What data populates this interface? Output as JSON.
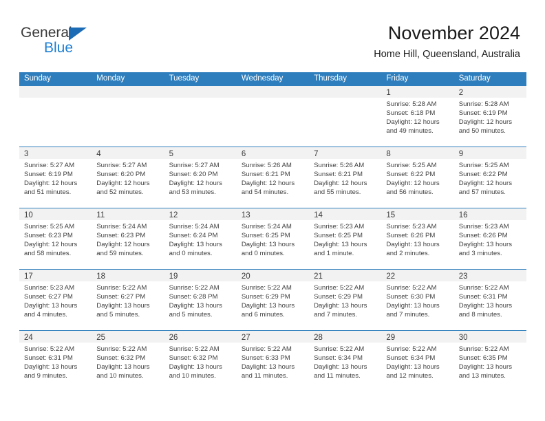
{
  "brand": {
    "name_part1": "General",
    "name_part2": "Blue",
    "accent_color": "#1c7fd4",
    "triangle_color": "#1c6bb5",
    "triangle_icon": "triangle-icon"
  },
  "header": {
    "title": "November 2024",
    "subtitle": "Home Hill, Queensland, Australia",
    "header_bg": "#2e7ebd",
    "datebar_bg": "#f2f2f2"
  },
  "calendar": {
    "weekday_headers": [
      "Sunday",
      "Monday",
      "Tuesday",
      "Wednesday",
      "Thursday",
      "Friday",
      "Saturday"
    ],
    "weeks": [
      [
        {
          "day": "",
          "sunrise": "",
          "sunset": "",
          "daylight1": "",
          "daylight2": ""
        },
        {
          "day": "",
          "sunrise": "",
          "sunset": "",
          "daylight1": "",
          "daylight2": ""
        },
        {
          "day": "",
          "sunrise": "",
          "sunset": "",
          "daylight1": "",
          "daylight2": ""
        },
        {
          "day": "",
          "sunrise": "",
          "sunset": "",
          "daylight1": "",
          "daylight2": ""
        },
        {
          "day": "",
          "sunrise": "",
          "sunset": "",
          "daylight1": "",
          "daylight2": ""
        },
        {
          "day": "1",
          "sunrise": "Sunrise: 5:28 AM",
          "sunset": "Sunset: 6:18 PM",
          "daylight1": "Daylight: 12 hours",
          "daylight2": "and 49 minutes."
        },
        {
          "day": "2",
          "sunrise": "Sunrise: 5:28 AM",
          "sunset": "Sunset: 6:19 PM",
          "daylight1": "Daylight: 12 hours",
          "daylight2": "and 50 minutes."
        }
      ],
      [
        {
          "day": "3",
          "sunrise": "Sunrise: 5:27 AM",
          "sunset": "Sunset: 6:19 PM",
          "daylight1": "Daylight: 12 hours",
          "daylight2": "and 51 minutes."
        },
        {
          "day": "4",
          "sunrise": "Sunrise: 5:27 AM",
          "sunset": "Sunset: 6:20 PM",
          "daylight1": "Daylight: 12 hours",
          "daylight2": "and 52 minutes."
        },
        {
          "day": "5",
          "sunrise": "Sunrise: 5:27 AM",
          "sunset": "Sunset: 6:20 PM",
          "daylight1": "Daylight: 12 hours",
          "daylight2": "and 53 minutes."
        },
        {
          "day": "6",
          "sunrise": "Sunrise: 5:26 AM",
          "sunset": "Sunset: 6:21 PM",
          "daylight1": "Daylight: 12 hours",
          "daylight2": "and 54 minutes."
        },
        {
          "day": "7",
          "sunrise": "Sunrise: 5:26 AM",
          "sunset": "Sunset: 6:21 PM",
          "daylight1": "Daylight: 12 hours",
          "daylight2": "and 55 minutes."
        },
        {
          "day": "8",
          "sunrise": "Sunrise: 5:25 AM",
          "sunset": "Sunset: 6:22 PM",
          "daylight1": "Daylight: 12 hours",
          "daylight2": "and 56 minutes."
        },
        {
          "day": "9",
          "sunrise": "Sunrise: 5:25 AM",
          "sunset": "Sunset: 6:22 PM",
          "daylight1": "Daylight: 12 hours",
          "daylight2": "and 57 minutes."
        }
      ],
      [
        {
          "day": "10",
          "sunrise": "Sunrise: 5:25 AM",
          "sunset": "Sunset: 6:23 PM",
          "daylight1": "Daylight: 12 hours",
          "daylight2": "and 58 minutes."
        },
        {
          "day": "11",
          "sunrise": "Sunrise: 5:24 AM",
          "sunset": "Sunset: 6:23 PM",
          "daylight1": "Daylight: 12 hours",
          "daylight2": "and 59 minutes."
        },
        {
          "day": "12",
          "sunrise": "Sunrise: 5:24 AM",
          "sunset": "Sunset: 6:24 PM",
          "daylight1": "Daylight: 13 hours",
          "daylight2": "and 0 minutes."
        },
        {
          "day": "13",
          "sunrise": "Sunrise: 5:24 AM",
          "sunset": "Sunset: 6:25 PM",
          "daylight1": "Daylight: 13 hours",
          "daylight2": "and 0 minutes."
        },
        {
          "day": "14",
          "sunrise": "Sunrise: 5:23 AM",
          "sunset": "Sunset: 6:25 PM",
          "daylight1": "Daylight: 13 hours",
          "daylight2": "and 1 minute."
        },
        {
          "day": "15",
          "sunrise": "Sunrise: 5:23 AM",
          "sunset": "Sunset: 6:26 PM",
          "daylight1": "Daylight: 13 hours",
          "daylight2": "and 2 minutes."
        },
        {
          "day": "16",
          "sunrise": "Sunrise: 5:23 AM",
          "sunset": "Sunset: 6:26 PM",
          "daylight1": "Daylight: 13 hours",
          "daylight2": "and 3 minutes."
        }
      ],
      [
        {
          "day": "17",
          "sunrise": "Sunrise: 5:23 AM",
          "sunset": "Sunset: 6:27 PM",
          "daylight1": "Daylight: 13 hours",
          "daylight2": "and 4 minutes."
        },
        {
          "day": "18",
          "sunrise": "Sunrise: 5:22 AM",
          "sunset": "Sunset: 6:27 PM",
          "daylight1": "Daylight: 13 hours",
          "daylight2": "and 5 minutes."
        },
        {
          "day": "19",
          "sunrise": "Sunrise: 5:22 AM",
          "sunset": "Sunset: 6:28 PM",
          "daylight1": "Daylight: 13 hours",
          "daylight2": "and 5 minutes."
        },
        {
          "day": "20",
          "sunrise": "Sunrise: 5:22 AM",
          "sunset": "Sunset: 6:29 PM",
          "daylight1": "Daylight: 13 hours",
          "daylight2": "and 6 minutes."
        },
        {
          "day": "21",
          "sunrise": "Sunrise: 5:22 AM",
          "sunset": "Sunset: 6:29 PM",
          "daylight1": "Daylight: 13 hours",
          "daylight2": "and 7 minutes."
        },
        {
          "day": "22",
          "sunrise": "Sunrise: 5:22 AM",
          "sunset": "Sunset: 6:30 PM",
          "daylight1": "Daylight: 13 hours",
          "daylight2": "and 7 minutes."
        },
        {
          "day": "23",
          "sunrise": "Sunrise: 5:22 AM",
          "sunset": "Sunset: 6:31 PM",
          "daylight1": "Daylight: 13 hours",
          "daylight2": "and 8 minutes."
        }
      ],
      [
        {
          "day": "24",
          "sunrise": "Sunrise: 5:22 AM",
          "sunset": "Sunset: 6:31 PM",
          "daylight1": "Daylight: 13 hours",
          "daylight2": "and 9 minutes."
        },
        {
          "day": "25",
          "sunrise": "Sunrise: 5:22 AM",
          "sunset": "Sunset: 6:32 PM",
          "daylight1": "Daylight: 13 hours",
          "daylight2": "and 10 minutes."
        },
        {
          "day": "26",
          "sunrise": "Sunrise: 5:22 AM",
          "sunset": "Sunset: 6:32 PM",
          "daylight1": "Daylight: 13 hours",
          "daylight2": "and 10 minutes."
        },
        {
          "day": "27",
          "sunrise": "Sunrise: 5:22 AM",
          "sunset": "Sunset: 6:33 PM",
          "daylight1": "Daylight: 13 hours",
          "daylight2": "and 11 minutes."
        },
        {
          "day": "28",
          "sunrise": "Sunrise: 5:22 AM",
          "sunset": "Sunset: 6:34 PM",
          "daylight1": "Daylight: 13 hours",
          "daylight2": "and 11 minutes."
        },
        {
          "day": "29",
          "sunrise": "Sunrise: 5:22 AM",
          "sunset": "Sunset: 6:34 PM",
          "daylight1": "Daylight: 13 hours",
          "daylight2": "and 12 minutes."
        },
        {
          "day": "30",
          "sunrise": "Sunrise: 5:22 AM",
          "sunset": "Sunset: 6:35 PM",
          "daylight1": "Daylight: 13 hours",
          "daylight2": "and 13 minutes."
        }
      ]
    ]
  }
}
